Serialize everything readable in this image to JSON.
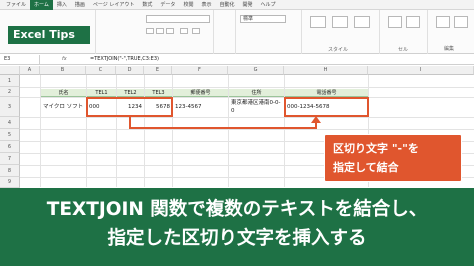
{
  "ribbon": {
    "tabs": [
      "ファイル",
      "ホーム",
      "挿入",
      "描画",
      "ページ レイアウト",
      "数式",
      "データ",
      "校閲",
      "表示",
      "自動化",
      "開発",
      "ヘルプ"
    ],
    "active_tab_index": 1,
    "number_format": "標準",
    "group_labels": [
      "スタイル",
      "セル",
      "編集"
    ]
  },
  "badge": {
    "text": "Excel Tips"
  },
  "formula_bar": {
    "name_box": "E3",
    "fx": "fx",
    "formula": "=TEXTJOIN(\"-\",TRUE,C3:E3)"
  },
  "columns": [
    "A",
    "B",
    "C",
    "D",
    "E",
    "F",
    "G",
    "H",
    "I"
  ],
  "rows": [
    "1",
    "2",
    "3",
    "4",
    "5",
    "6",
    "7",
    "8",
    "9"
  ],
  "table": {
    "headers": [
      "氏名",
      "TEL1",
      "TEL2",
      "TEL3",
      "郵便番号",
      "住所",
      "電話番号"
    ],
    "row": [
      "マイクロ ソフト",
      "000",
      "1234",
      "5678",
      "123-4567",
      "東京都港区港南0-0-0",
      "000-1234-5678"
    ]
  },
  "annotation": {
    "line1": "区切り文字 \"-\"を",
    "line2": "指定して結合"
  },
  "title": {
    "line1": "TEXTJOIN 関数で複数のテキストを結合し、",
    "line2": "指定した区切り文字を挿入する"
  },
  "colors": {
    "brand_green": "#1e7145",
    "accent_orange": "#e0562e",
    "header_fill": "#e2efda"
  }
}
